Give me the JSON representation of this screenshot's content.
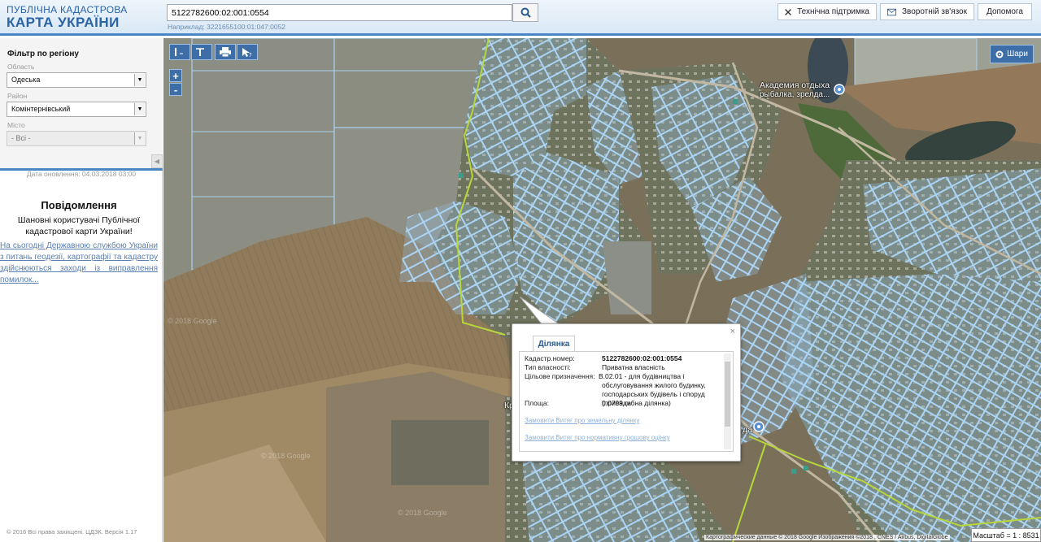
{
  "header": {
    "logo_line1": "ПУБЛІЧНА КАДАСТРОВА",
    "logo_line2": "КАРТА УКРАЇНИ",
    "search_value": "5122782600:02:001:0554",
    "search_example": "Наприклад: 3221655100:01:047:0052",
    "btn_support": "Технічна підтримка",
    "btn_feedback": "Зворотній зв'язок",
    "btn_help": "Допомога"
  },
  "sidebar": {
    "filter_title": "Фільтр по регіону",
    "oblast_label": "Область",
    "oblast_value": "Одеська",
    "rayon_label": "Район",
    "rayon_value": "Комінтернівський",
    "city_label": "Місто",
    "city_value": "- Всі -",
    "update_date": "Дата оновлення: 04.03.2018 03:00",
    "notice_title": "Повідомлення",
    "notice_text": "Шановні користувачі Публічної кадастрової карти України!",
    "notice_link": "На сьогодні Державною службою України з питань геодезії, картографії та кадастру здійснюються заходи із виправлення помилок...",
    "copyright": "© 2016 Всі права захищені. ЦДЗК. Версія 1.17"
  },
  "map": {
    "layers_label": "Шари",
    "zoom_in": "+",
    "zoom_out": "-",
    "place_label_1": "Академия отдыха",
    "place_label_2": "рыбалка, зрелда...",
    "place_fragment_left": "Кр",
    "place_fragment_right": "да",
    "watermark": "© 2018 Google",
    "attribution": "Картографические данные © 2018 Google Изображения ©2018 , CNES / Airbus, DigitalGlobe",
    "scale": "Масштаб = 1 : 8531"
  },
  "popup": {
    "tab_label": "Ділянка",
    "close_symbol": "×",
    "rows": [
      {
        "label": "Кадастр.номер:",
        "value": "5122782600:02:001:0554"
      },
      {
        "label": "Тип власності:",
        "value": "Приватна власність"
      },
      {
        "label": "Цільове призначення:",
        "value": "В.02.01 - для будівництва і обслуговування жилого будинку, господарських будівель і споруд (присадибна ділянка)"
      },
      {
        "label": "Площа:",
        "value": "0.0799 га"
      }
    ],
    "link1": "Замовити Витяг про земельну ділянку",
    "link2": "Замовити Витяг про нормативну грошову оцінку"
  }
}
